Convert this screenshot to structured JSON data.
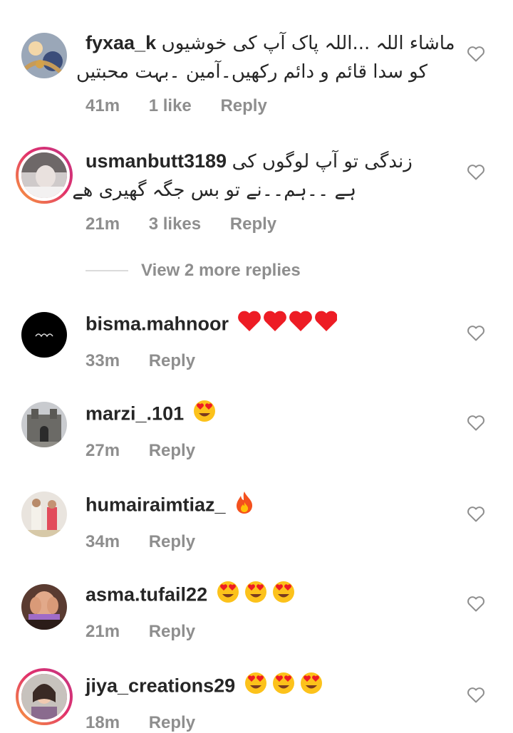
{
  "comments": [
    {
      "username": "fyxaa_k",
      "text_line1": "ماشاء اللہ ...اللہ پاک آپ کی خوشیوں",
      "text_line2": "کو سدا قائم و دائم رکھیں۔آمین ۔بہت محبتیں",
      "time": "41m",
      "likes": "1 like",
      "reply": "Reply"
    },
    {
      "username": "usmanbutt3189",
      "text_line1": "زندگی تو آپ لوگوں کی",
      "text_line2": "ہے ۔۔ہم۔۔نے تو بس جگہ گھیری ھے",
      "time": "21m",
      "likes": "3 likes",
      "reply": "Reply"
    },
    {
      "username": "bisma.mahnoor",
      "emojis": "❤️❤️❤️❤️",
      "time": "33m",
      "reply": "Reply"
    },
    {
      "username": "marzi_.101",
      "emojis": "😍",
      "time": "27m",
      "reply": "Reply"
    },
    {
      "username": "humairaimtiaz_",
      "emojis": "🔥",
      "time": "34m",
      "reply": "Reply"
    },
    {
      "username": "asma.tufail22",
      "emojis": "😍😍😍",
      "time": "21m",
      "reply": "Reply"
    },
    {
      "username": "jiya_creations29",
      "emojis": "😍😍😍",
      "time": "18m",
      "reply": "Reply"
    }
  ],
  "view_more": "View 2 more replies",
  "icons": {
    "like": "heart-outline-icon"
  },
  "colors": {
    "meta": "#8e8e8e",
    "text": "#262626",
    "heart_red": "#ed1c24"
  }
}
